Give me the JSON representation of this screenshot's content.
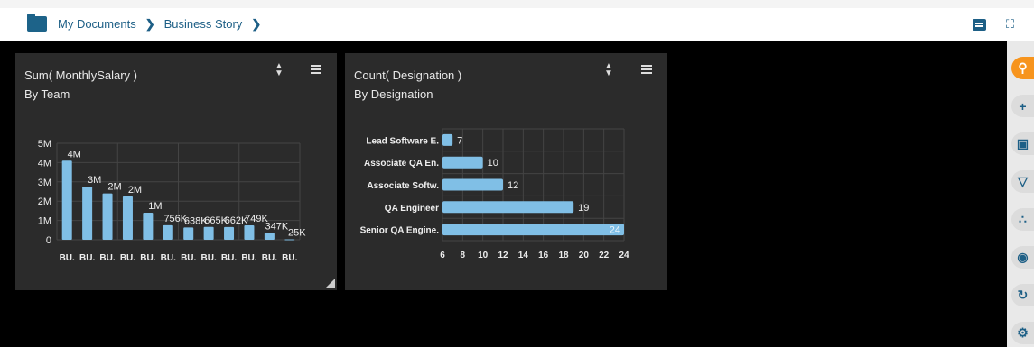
{
  "breadcrumb": {
    "items": [
      "My Documents",
      "Business Story"
    ]
  },
  "panels": [
    {
      "title": "Sum( MonthlySalary )",
      "subtitle": "By Team"
    },
    {
      "title": "Count( Designation )",
      "subtitle": "By Designation"
    }
  ],
  "icons": {
    "folder": "folder-icon",
    "chevron": "chevron-right-icon",
    "comment": "comment-icon",
    "fullscreen": "fullscreen-icon",
    "sort": "sort-icon",
    "menu": "menu-icon",
    "resize": "resize-icon"
  },
  "sidebar": {
    "items": [
      "search",
      "plus",
      "save",
      "filter",
      "share",
      "eye",
      "refresh",
      "gear"
    ]
  },
  "colors": {
    "bar": "#80bfe6",
    "panel": "#2b2b2b",
    "accent": "#f7941d",
    "brand": "#1d5f86"
  },
  "chart_data": [
    {
      "type": "bar",
      "categories": [
        "BU.",
        "BU.",
        "BU.",
        "BU.",
        "BU.",
        "BU.",
        "BU.",
        "BU.",
        "BU.",
        "BU.",
        "BU.",
        "BU."
      ],
      "values": [
        4100000,
        2750000,
        2400000,
        2250000,
        1400000,
        756000,
        638000,
        665000,
        662000,
        749000,
        347000,
        25000
      ],
      "data_labels": [
        "4M",
        "3M",
        "2M",
        "2M",
        "1M",
        "756K",
        "638K",
        "665K",
        "662K",
        "749K",
        "347K",
        "25K"
      ],
      "yticks": [
        "0",
        "1M",
        "2M",
        "3M",
        "4M",
        "5M"
      ],
      "ylim": [
        0,
        5000000
      ],
      "title": "Sum( MonthlySalary )",
      "subtitle": "By Team",
      "grid": true
    },
    {
      "type": "bar",
      "orientation": "horizontal",
      "categories": [
        "Lead Software E.",
        "Associate QA En.",
        "Associate Softw.",
        "QA Engineer",
        "Senior QA Engine."
      ],
      "values": [
        7,
        10,
        12,
        19,
        24
      ],
      "xticks": [
        "6",
        "8",
        "10",
        "12",
        "14",
        "16",
        "18",
        "20",
        "22",
        "24"
      ],
      "xlim": [
        6,
        24
      ],
      "title": "Count( Designation )",
      "subtitle": "By Designation",
      "grid": true
    }
  ]
}
